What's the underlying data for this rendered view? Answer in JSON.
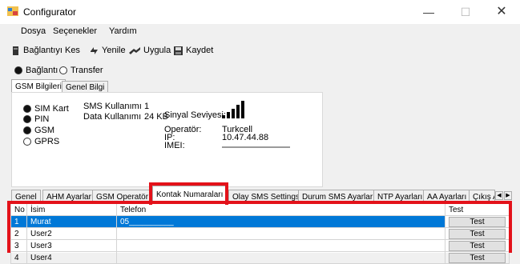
{
  "window": {
    "title": "Configurator",
    "minimize": "—",
    "maximize": "☐",
    "close": "✕"
  },
  "menu": [
    "Dosya",
    "Seçenekler",
    "Yardım"
  ],
  "toolbar": {
    "disconnect": "Bağlantıyı Kes",
    "refresh": "Yenile",
    "apply": "Uygula",
    "save": "Kaydet"
  },
  "mode": {
    "connection": "Bağlantı",
    "transfer": "Transfer",
    "selected": "connection"
  },
  "top_tabs": [
    "GSM Bilgileri",
    "Genel Bilgi"
  ],
  "gsm": {
    "status": [
      {
        "label": "SIM Kart",
        "on": true
      },
      {
        "label": "PIN",
        "on": true
      },
      {
        "label": "GSM",
        "on": true
      },
      {
        "label": "GPRS",
        "on": false
      }
    ],
    "sms_usage_label": "SMS Kullanımı",
    "sms_usage_value": "1",
    "data_usage_label": "Data Kullanımı",
    "data_usage_value": "24 KB",
    "signal_label": "Sinyal Seviyesi:",
    "signal_bars": 5,
    "operator_label": "Operatör:",
    "operator_value": "Turkcell",
    "ip_label": "IP:",
    "ip_value": "10.47.44.88",
    "imei_label": "IMEI:"
  },
  "bottom_tabs": [
    "Genel",
    "AHM Ayarları",
    "GSM Operatör",
    "Kontak Numaraları",
    "Olay SMS Settings",
    "Durum SMS Ayarları",
    "NTP Ayarları",
    "AA Ayarları",
    "Çıkış A"
  ],
  "bottom_tabs_active": 3,
  "scroll": {
    "left": "◀",
    "right": "▶"
  },
  "contacts": {
    "headers": {
      "no": "No",
      "name": "İsim",
      "phone": "Telefon",
      "test": "Test"
    },
    "rows": [
      {
        "no": "1",
        "name": "Murat",
        "phone": "05__________",
        "test": "Test"
      },
      {
        "no": "2",
        "name": "User2",
        "phone": "",
        "test": "Test"
      },
      {
        "no": "3",
        "name": "User3",
        "phone": "",
        "test": "Test"
      },
      {
        "no": "4",
        "name": "User4",
        "phone": "",
        "test": "Test"
      }
    ],
    "selected_row": 0
  },
  "colors": {
    "highlight": "#e3121a",
    "selection": "#0078d7"
  }
}
